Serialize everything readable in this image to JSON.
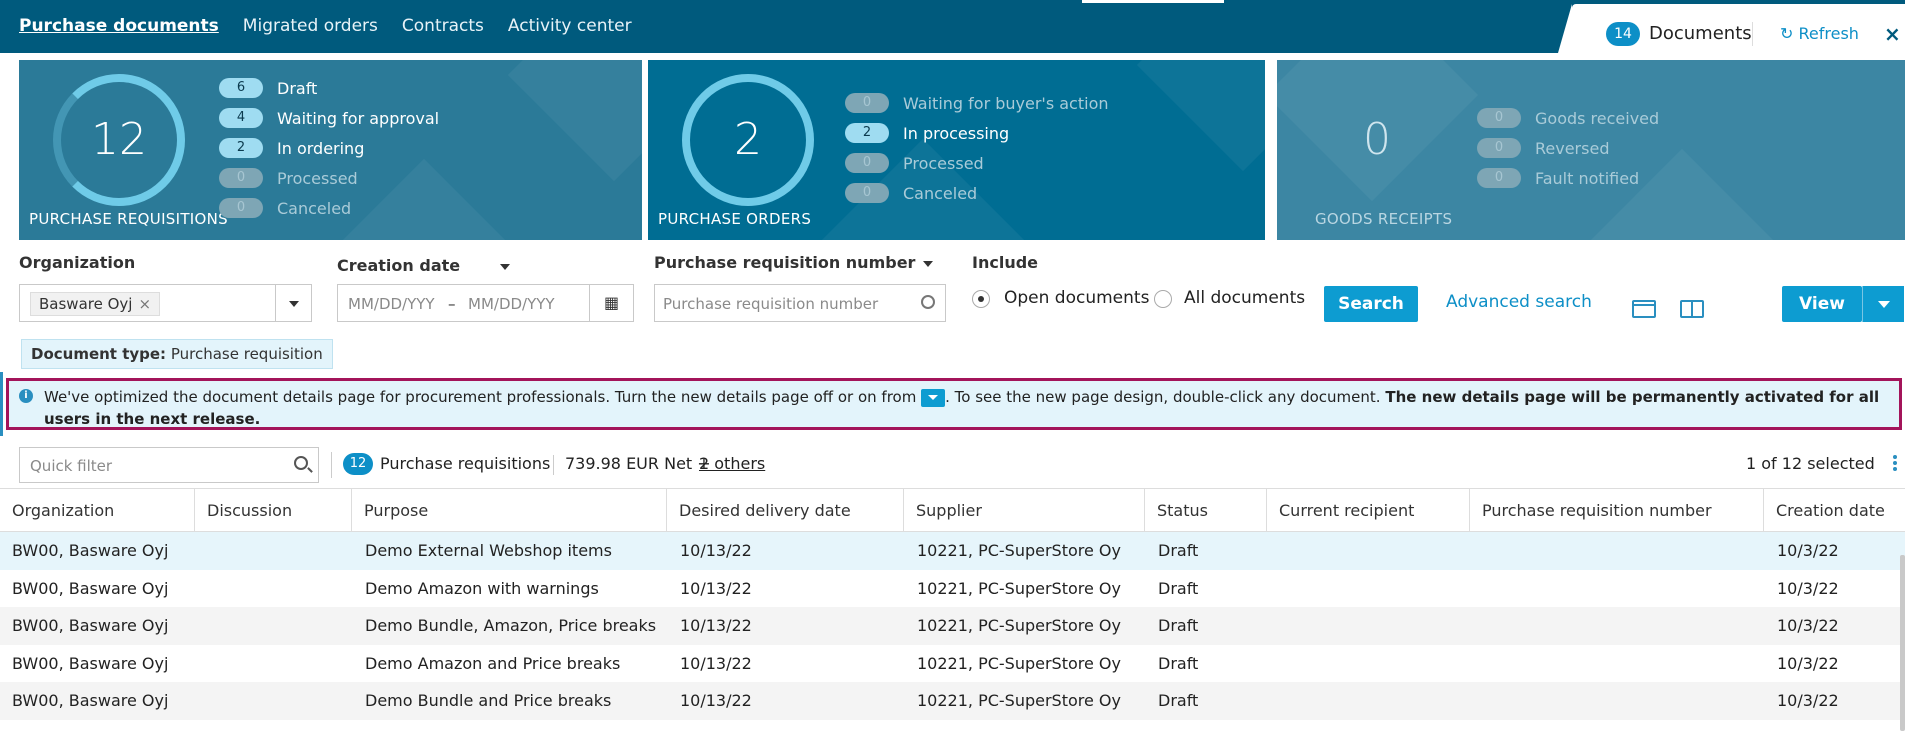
{
  "nav": {
    "tabs": [
      "Purchase documents",
      "Migrated orders",
      "Contracts",
      "Activity center"
    ],
    "documents_count": "14",
    "documents_label": "Documents",
    "refresh_label": "Refresh",
    "close_glyph": "×"
  },
  "cards": {
    "requisitions": {
      "total": "12",
      "title": "PURCHASE REQUISITIONS",
      "statuses": [
        {
          "count": "6",
          "label": "Draft"
        },
        {
          "count": "4",
          "label": "Waiting for approval"
        },
        {
          "count": "2",
          "label": "In ordering"
        },
        {
          "count": "0",
          "label": "Processed"
        },
        {
          "count": "0",
          "label": "Canceled"
        }
      ]
    },
    "orders": {
      "total": "2",
      "title": "PURCHASE ORDERS",
      "statuses": [
        {
          "count": "0",
          "label": "Waiting for buyer's action"
        },
        {
          "count": "2",
          "label": "In processing"
        },
        {
          "count": "0",
          "label": "Processed"
        },
        {
          "count": "0",
          "label": "Canceled"
        }
      ]
    },
    "receipts": {
      "total": "0",
      "title": "GOODS RECEIPTS",
      "statuses": [
        {
          "count": "0",
          "label": "Goods received"
        },
        {
          "count": "0",
          "label": "Reversed"
        },
        {
          "count": "0",
          "label": "Fault notified"
        }
      ]
    }
  },
  "filters": {
    "organization_label": "Organization",
    "organization_value": "Basware Oyj",
    "creation_date_label": "Creation date",
    "date_from_placeholder": "MM/DD/YYY",
    "date_to_placeholder": "MM/DD/YYY",
    "date_separator": "–",
    "prn_label": "Purchase requisition number",
    "prn_placeholder": "Purchase requisition number",
    "include_label": "Include",
    "open_documents": "Open documents",
    "all_documents": "All documents",
    "search_label": "Search",
    "advanced_search_label": "Advanced search",
    "view_label": "View",
    "doc_type_key": "Document type:",
    "doc_type_value": "Purchase requisition"
  },
  "banner": {
    "text_before": "We've optimized the document details page for procurement professionals. Turn the new details page off or on from",
    "text_after": ". To see the new page design, double-click any document.",
    "text_bold": "The new details page will be permanently activated for all users in the next release."
  },
  "list": {
    "quick_filter_placeholder": "Quick filter",
    "count": "12",
    "count_label": "Purchase requisitions",
    "amount": "739.98 EUR Net +",
    "others_link": "2 others",
    "selection": "1 of 12 selected"
  },
  "table": {
    "columns": [
      "Organization",
      "Discussion",
      "Purpose",
      "Desired delivery date",
      "Supplier",
      "Status",
      "Current recipient",
      "Purchase requisition number",
      "Creation date"
    ],
    "rows": [
      [
        "BW00, Basware Oyj",
        "",
        "Demo External Webshop items",
        "10/13/22",
        "10221, PC-SuperStore Oy",
        "Draft",
        "",
        "",
        "10/3/22"
      ],
      [
        "BW00, Basware Oyj",
        "",
        "Demo Amazon with warnings",
        "10/13/22",
        "10221, PC-SuperStore Oy",
        "Draft",
        "",
        "",
        "10/3/22"
      ],
      [
        "BW00, Basware Oyj",
        "",
        "Demo Bundle, Amazon, Price breaks",
        "10/13/22",
        "10221, PC-SuperStore Oy",
        "Draft",
        "",
        "",
        "10/3/22"
      ],
      [
        "BW00, Basware Oyj",
        "",
        "Demo Amazon and Price breaks",
        "10/13/22",
        "10221, PC-SuperStore Oy",
        "Draft",
        "",
        "",
        "10/3/22"
      ],
      [
        "BW00, Basware Oyj",
        "",
        "Demo Bundle and Price breaks",
        "10/13/22",
        "10221, PC-SuperStore Oy",
        "Draft",
        "",
        "",
        "10/3/22"
      ]
    ]
  },
  "colors": {
    "brand": "#005a7d",
    "accent": "#0d9cd1",
    "highlight": "#a3145a"
  }
}
